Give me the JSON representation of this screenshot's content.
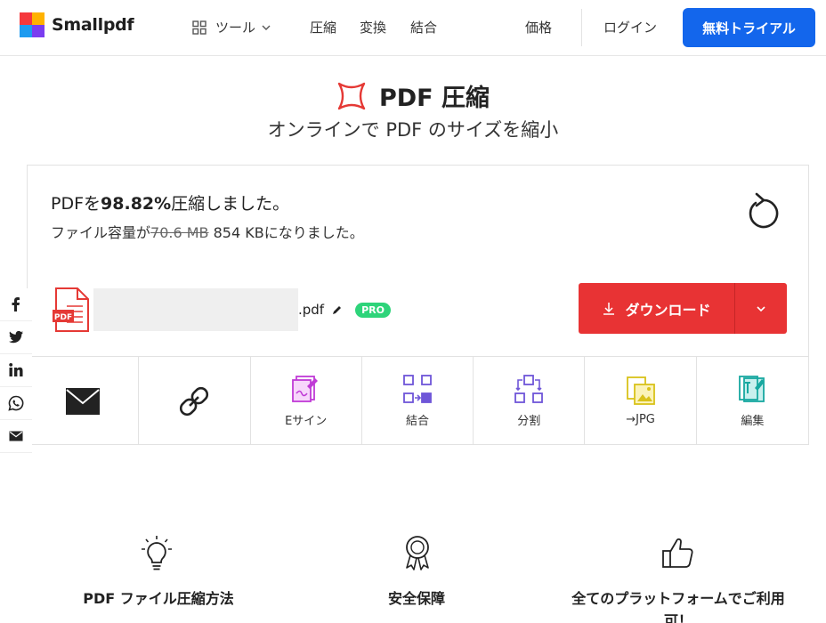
{
  "header": {
    "logo_text": "Smallpdf",
    "nav_tools": "ツール",
    "nav_compress": "圧縮",
    "nav_convert": "変換",
    "nav_merge": "結合",
    "nav_price": "価格",
    "nav_login": "ログイン",
    "trial_button": "無料トライアル"
  },
  "page": {
    "title": "PDF 圧縮",
    "subtitle": "オンラインで PDF のサイズを縮小"
  },
  "result": {
    "prefix": "PDFを",
    "percent": "98.82%",
    "suffix": "圧縮しました。",
    "size_prefix": "ファイル容量が",
    "old_size": "70.6 MB",
    "new_size": " 854 KB",
    "size_suffix": "になりました。"
  },
  "file": {
    "pdf_label": "PDF",
    "extension": ".pdf",
    "badge": "PRO"
  },
  "download": {
    "label": "ダウンロード"
  },
  "actions": [
    {
      "label": ""
    },
    {
      "label": ""
    },
    {
      "label": "Eサイン"
    },
    {
      "label": "結合"
    },
    {
      "label": "分割"
    },
    {
      "label": "→JPG"
    },
    {
      "label": "編集"
    }
  ],
  "features": [
    {
      "title": "PDF ファイル圧縮方法"
    },
    {
      "title": "安全保障"
    },
    {
      "title": "全てのプラットフォームでご利用"
    },
    {
      "title_line2": "可！"
    }
  ],
  "colors": {
    "brand_blue": "#1366ec",
    "download_red": "#e83334",
    "pro_green": "#2ed47a",
    "compress_red": "#e53935"
  }
}
